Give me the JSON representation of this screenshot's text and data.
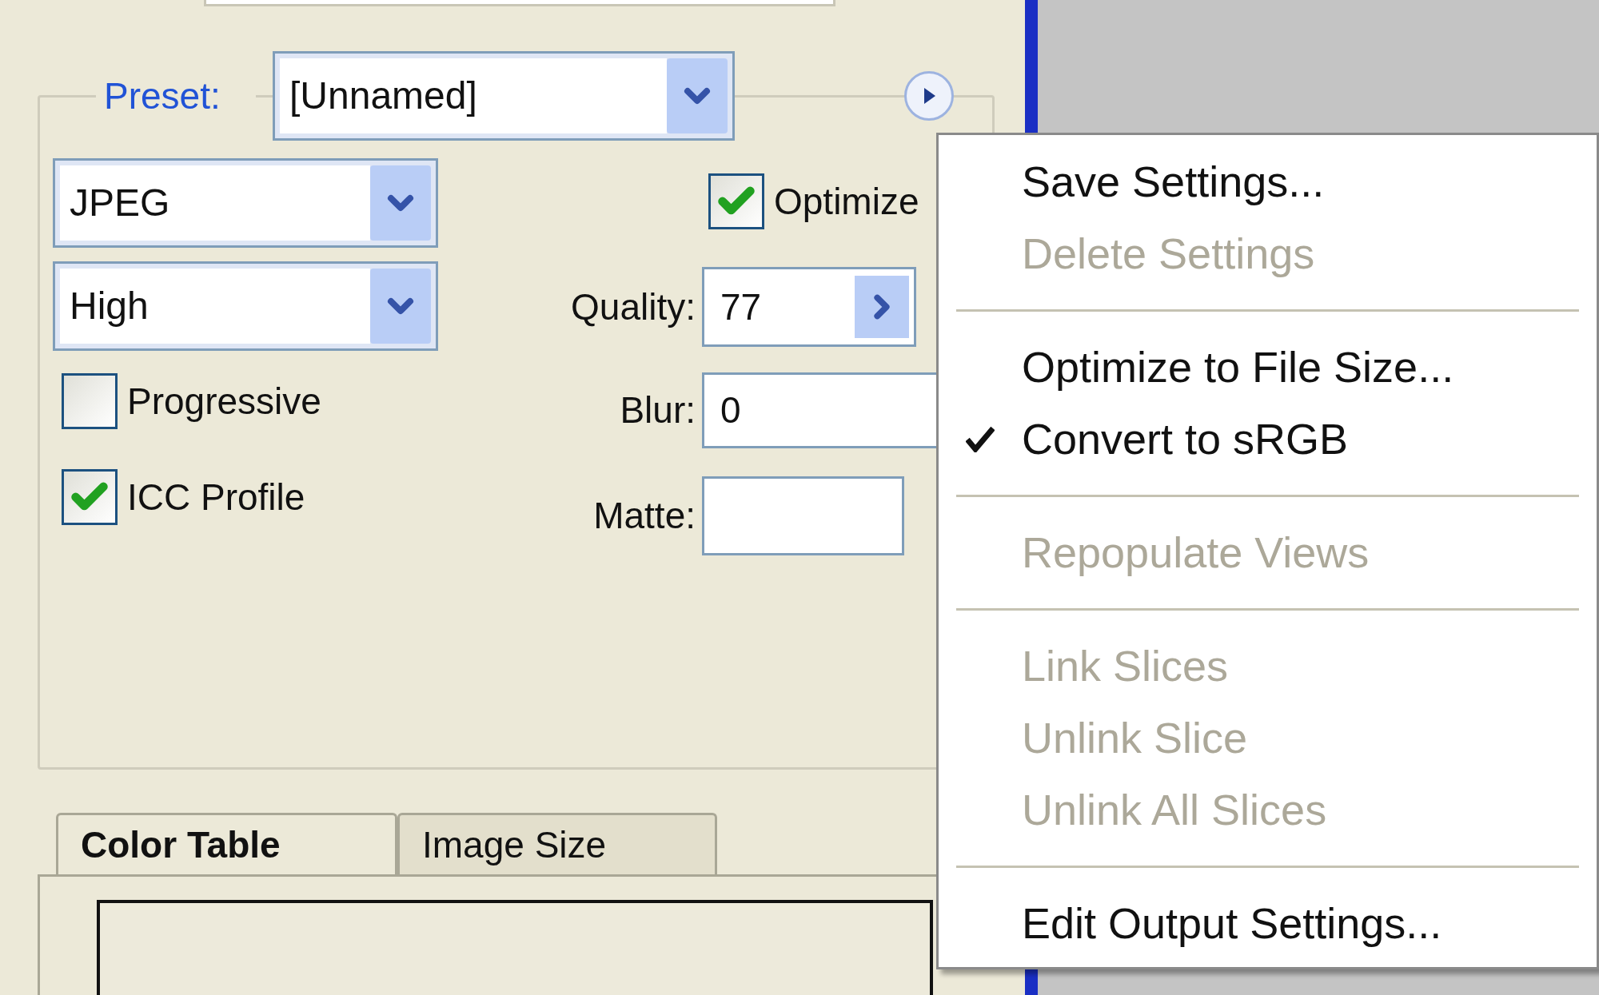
{
  "preset": {
    "label": "Preset:",
    "value": "[Unnamed]"
  },
  "format": {
    "value": "JPEG"
  },
  "quality_preset": {
    "value": "High"
  },
  "checkboxes": [
    {
      "label": "Optimize",
      "checked": true
    },
    {
      "label": "Progressive",
      "checked": false
    },
    {
      "label": "ICC Profile",
      "checked": true
    }
  ],
  "fields": [
    {
      "label": "Quality:",
      "value": "77"
    },
    {
      "label": "Blur:",
      "value": "0"
    },
    {
      "label": "Matte:"
    }
  ],
  "tabs": [
    {
      "label": "Color Table",
      "selected": true
    },
    {
      "label": "Image Size",
      "selected": false
    }
  ],
  "menu": [
    {
      "kind": "item",
      "label": "Save Settings...",
      "disabled": false,
      "checked": false
    },
    {
      "kind": "item",
      "label": "Delete Settings",
      "disabled": true,
      "checked": false
    },
    {
      "kind": "separator"
    },
    {
      "kind": "item",
      "label": "Optimize to File Size...",
      "disabled": false,
      "checked": false
    },
    {
      "kind": "item",
      "label": "Convert to sRGB",
      "disabled": false,
      "checked": true
    },
    {
      "kind": "separator"
    },
    {
      "kind": "item",
      "label": "Repopulate Views",
      "disabled": true,
      "checked": false
    },
    {
      "kind": "separator"
    },
    {
      "kind": "item",
      "label": "Link Slices",
      "disabled": true,
      "checked": false
    },
    {
      "kind": "item",
      "label": "Unlink Slice",
      "disabled": true,
      "checked": false
    },
    {
      "kind": "item",
      "label": "Unlink All Slices",
      "disabled": true,
      "checked": false
    },
    {
      "kind": "separator"
    },
    {
      "kind": "item",
      "label": "Edit Output Settings...",
      "disabled": false,
      "checked": false
    }
  ]
}
